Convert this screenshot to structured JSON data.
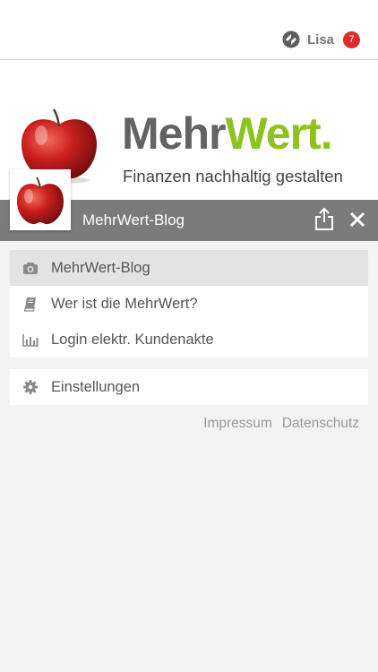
{
  "user": {
    "name": "Lisa",
    "notifications": "7",
    "logo_icon": "app-logo-icon"
  },
  "header": {
    "brand_part1": "Mehr",
    "brand_part2": "Wert",
    "brand_dot": ".",
    "tagline": "Finanzen nachhaltig gestalten"
  },
  "titlebar": {
    "title": "MehrWert-Blog",
    "share_icon": "share-icon",
    "close_icon": "close-icon"
  },
  "menu": {
    "items": [
      {
        "label": "MehrWert-Blog",
        "icon": "camera-icon",
        "active": true
      },
      {
        "label": "Wer ist die MehrWert?",
        "icon": "book-icon",
        "active": false
      },
      {
        "label": "Login elektr. Kundenakte",
        "icon": "bar-chart-icon",
        "active": false
      }
    ],
    "settings": {
      "label": "Einstellungen",
      "icon": "gear-icon"
    }
  },
  "footer": {
    "impressum": "Impressum",
    "datenschutz": "Datenschutz"
  },
  "colors": {
    "brand_gray": "#636363",
    "brand_green": "#8dc21f",
    "titlebar_bg": "#7b7b7b",
    "badge": "#e0292b",
    "panel_bg": "#f3f3f3"
  }
}
